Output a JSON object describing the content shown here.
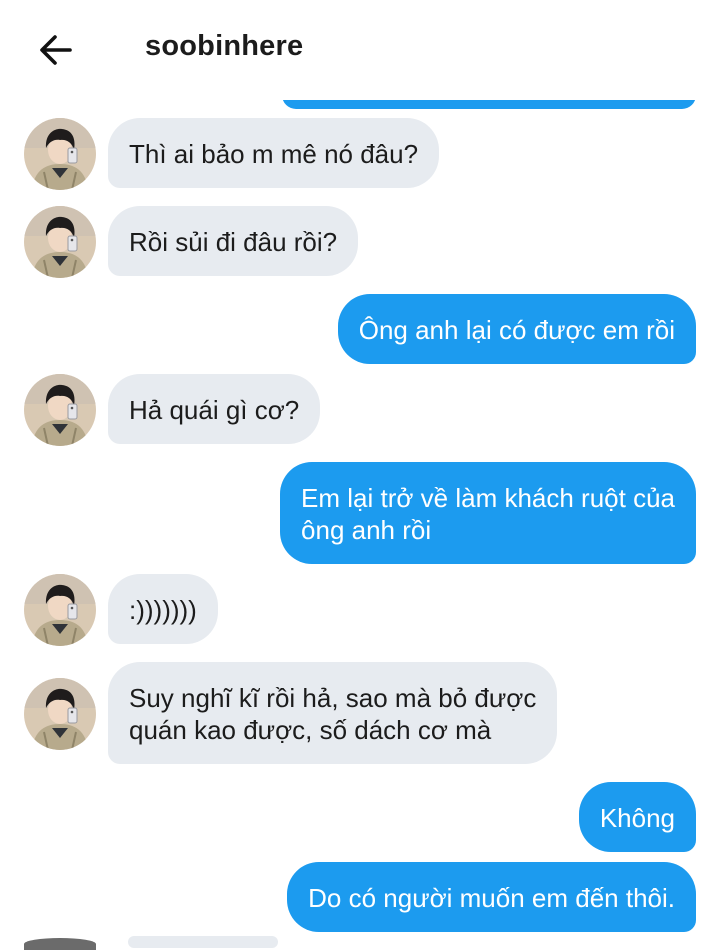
{
  "header": {
    "back_icon": "arrow-left-icon",
    "title": "soobinhere"
  },
  "colors": {
    "outgoing": "#1c9bef",
    "incoming": "#e7ebf0",
    "text_dark": "#1c1c1c",
    "text_light": "#ffffff"
  },
  "contact": {
    "avatar_icon": "contact-avatar"
  },
  "messages": [
    {
      "dir": "in",
      "lines": [
        "Thì ai bảo m mê nó đâu?"
      ]
    },
    {
      "dir": "in",
      "lines": [
        "Rồi sủi đi đâu rồi?"
      ]
    },
    {
      "dir": "out",
      "lines": [
        "Ông anh lại có được em rồi"
      ]
    },
    {
      "dir": "in",
      "lines": [
        "Hả quái gì cơ?"
      ]
    },
    {
      "dir": "out",
      "lines": [
        "Em lại trở về làm khách ruột của",
        "ông anh rồi"
      ]
    },
    {
      "dir": "in",
      "lines": [
        ":)))))))"
      ]
    },
    {
      "dir": "in",
      "lines": [
        "Suy nghĩ kĩ rồi hả, sao mà bỏ được",
        "quán kao được, số dách cơ mà"
      ]
    },
    {
      "dir": "out",
      "lines": [
        "Không"
      ]
    },
    {
      "dir": "out",
      "lines": [
        "Do có người muốn em đến thôi."
      ]
    }
  ]
}
